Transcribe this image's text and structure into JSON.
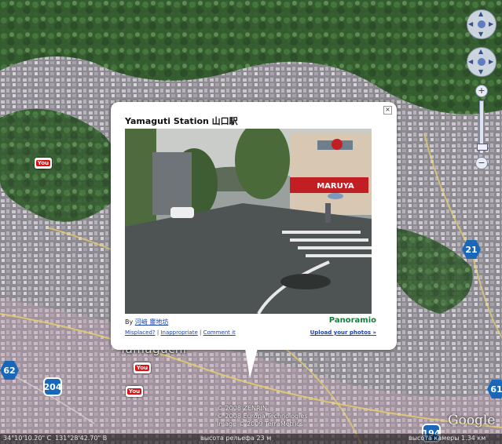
{
  "balloon": {
    "title": "Yamaguti Station 山口駅",
    "by_prefix": "By",
    "author": "河﨑 靈地坊",
    "links": {
      "misplaced": "Misplaced?",
      "inappropriate": "Inappropriate",
      "comment": "Comment it",
      "separator": "|"
    },
    "brand": "Panoramio",
    "upload": "Upload your photos »",
    "close_symbol": "×",
    "photo": {
      "store_sign": "MARUYA"
    }
  },
  "map": {
    "city_label": "Yamaguchi",
    "routes": [
      "62",
      "204",
      "21",
      "194",
      "61"
    ],
    "copyright_lines": [
      "© 2008 ZENRIN",
      "© 2008 Europa Technologies",
      "Image © 2009 TerraMetrics"
    ],
    "logo": "Google"
  },
  "nav": {
    "zoom_plus": "+",
    "zoom_minus": "−"
  },
  "statusbar": {
    "lat": "34°10'10.20\" С",
    "lon": "131°28'42.70\" В",
    "elevation": "высота рельефа   23 м",
    "eye_alt": "высота камеры   1.34 км"
  },
  "colors": {
    "route_shield": "#1967b8",
    "link": "#1a44aa",
    "panoramio_green": "#1b7a3e"
  }
}
